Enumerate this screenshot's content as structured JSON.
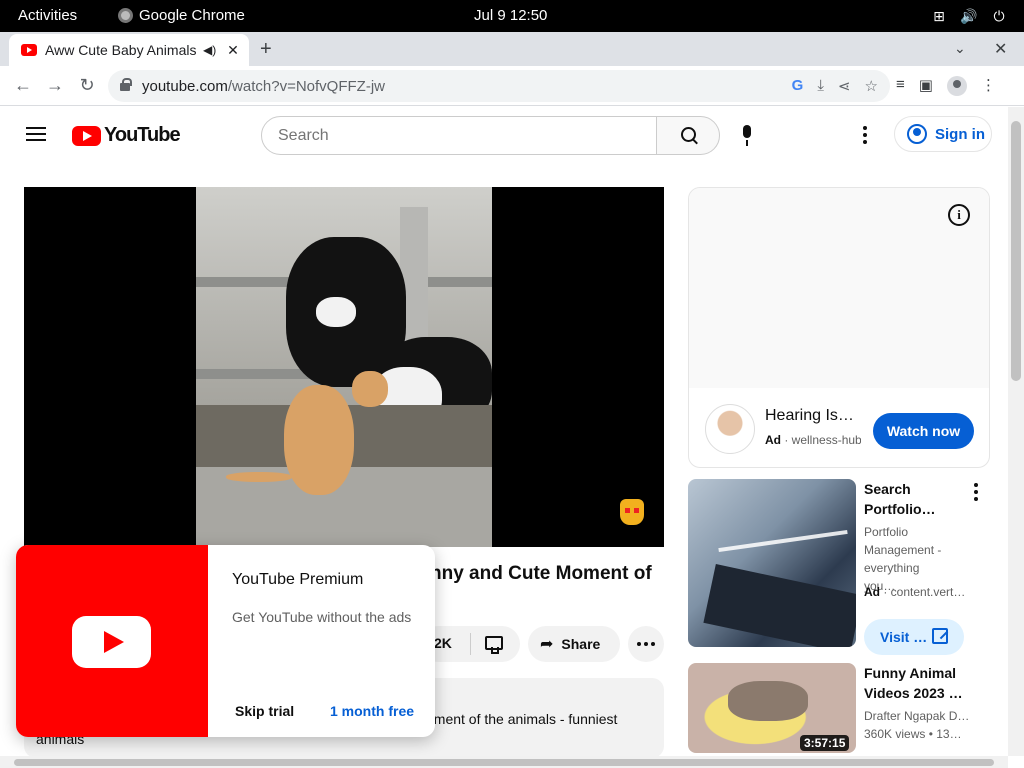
{
  "system": {
    "activities": "Activities",
    "app_name": "Google Chrome",
    "clock": "Jul 9  12:50",
    "tray_icons": [
      "network-icon",
      "volume-icon",
      "power-icon"
    ]
  },
  "browser": {
    "tab_title": "Aww Cute Baby Animals",
    "new_tab": "+",
    "tab_close": "✕",
    "url_host": "youtube.com",
    "url_path": "/watch?v=NofvQFFZ-jw",
    "window_close": "✕"
  },
  "youtube": {
    "logo_text": "YouTube",
    "search_placeholder": "Search",
    "sign_in": "Sign in",
    "video_title": "nny and Cute Moment of",
    "like_count": "2K",
    "share_label": "Share",
    "description_line1": "oment of the animals - funniest",
    "description_line2": "animals"
  },
  "promo": {
    "title": "YouTube Premium",
    "subtitle": "Get YouTube without the ads",
    "skip": "Skip trial",
    "free": "1 month free"
  },
  "ad": {
    "title": "Hearing Iss…",
    "badge": "Ad",
    "advertiser": "wellness-hub",
    "cta": "Watch now"
  },
  "sidebar": [
    {
      "title": "Search Portfolio…",
      "description": "Portfolio Management - everything you…",
      "badge": "Ad",
      "source": "content.vert…",
      "cta": "Visit …"
    },
    {
      "title": "Funny Animal Videos 2023 …",
      "channel": "Drafter Ngapak D…",
      "views": "360K views",
      "age": "13…",
      "duration": "3:57:15"
    }
  ],
  "colors": {
    "brand_red": "#ff0000",
    "link_blue": "#065fd4"
  }
}
